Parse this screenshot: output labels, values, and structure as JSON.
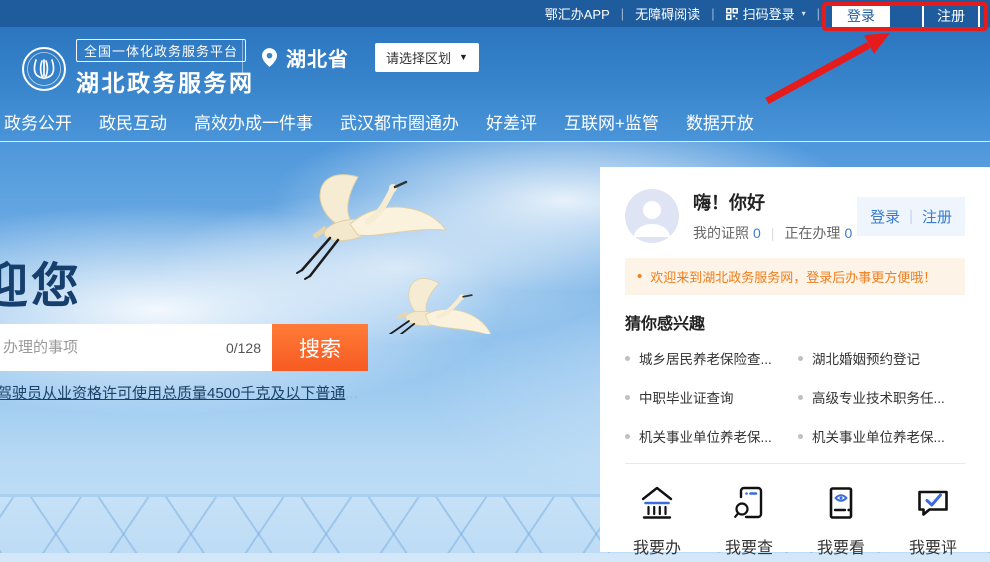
{
  "topbar": {
    "links": [
      "鄂汇办APP",
      "无障碍阅读",
      "扫码登录"
    ],
    "login_label": "登录",
    "register_label": "注册"
  },
  "header": {
    "platform_badge": "全国一体化政务服务平台",
    "site_name": "湖北政务服务网",
    "province": "湖北省",
    "region_selector": "请选择区划"
  },
  "nav": {
    "items": [
      "政务公开",
      "政民互动",
      "高效办成一件事",
      "武汉都市圈通办",
      "好差评",
      "互联网+监管",
      "数据开放"
    ]
  },
  "hero": {
    "title_visible": "迎您",
    "search": {
      "placeholder": "办理的事项",
      "counter": "0/128",
      "button_label": "搜索"
    },
    "hot_link": "驾驶员从业资格许可使用总质量4500千克及以下普通",
    "hot_link_ellipsis": "..."
  },
  "panel": {
    "greeting": "嗨！你好",
    "stats": [
      {
        "label": "我的证照",
        "value": "0"
      },
      {
        "label": "正在办理",
        "value": "0"
      }
    ],
    "login_label": "登录",
    "register_label": "注册",
    "notice_bullet": "•",
    "notice": "欢迎来到湖北政务服务网，登录后办事更方便哦！",
    "section_title": "猜你感兴趣",
    "interest_links": [
      "城乡居民养老保险查...",
      "湖北婚姻预约登记",
      "中职毕业证查询",
      "高级专业技术职务任...",
      "机关事业单位养老保...",
      "机关事业单位养老保..."
    ],
    "actions": [
      {
        "label": "我要办",
        "icon": "bank-icon"
      },
      {
        "label": "我要查",
        "icon": "document-search-icon"
      },
      {
        "label": "我要看",
        "icon": "monitor-eye-icon"
      },
      {
        "label": "我要评",
        "icon": "comment-check-icon"
      }
    ]
  },
  "icons": {
    "caret_down": "▼",
    "caret_small": "▾",
    "pipe": "|"
  },
  "colors": {
    "topbar_blue": "#1e5c9e",
    "header_blue_top": "#2b76bf",
    "header_blue_bottom": "#4a95d9",
    "accent_orange": "#f75b22",
    "annotation_red": "#e61c1c",
    "link_blue": "#3a7bd0",
    "notice_orange": "#ee7e1e",
    "title_navy": "#163f6d"
  }
}
